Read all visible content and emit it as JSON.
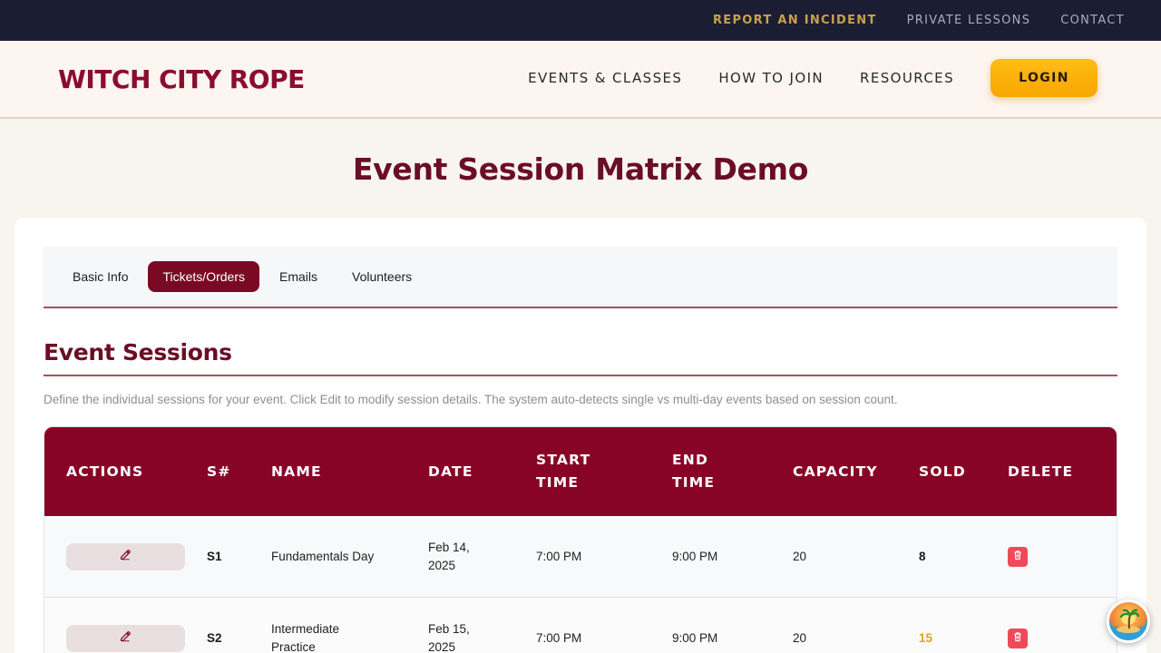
{
  "utility_nav": {
    "report_incident": "REPORT AN INCIDENT",
    "private_lessons": "PRIVATE LESSONS",
    "contact": "CONTACT"
  },
  "header": {
    "logo": "WITCH CITY ROPE",
    "nav": {
      "events": "EVENTS & CLASSES",
      "join": "HOW TO JOIN",
      "resources": "RESOURCES"
    },
    "login": "LOGIN"
  },
  "page": {
    "title": "Event Session Matrix Demo"
  },
  "tabs": [
    "Basic Info",
    "Tickets/Orders",
    "Emails",
    "Volunteers"
  ],
  "active_tab": "Tickets/Orders",
  "sessions": {
    "title": "Event Sessions",
    "description": "Define the individual sessions for your event. Click Edit to modify session details. The system auto-detects single vs multi-day events based on session count.",
    "columns": {
      "actions": "ACTIONS",
      "snum": "S#",
      "name": "NAME",
      "date": "DATE",
      "start": "START TIME",
      "end": "END TIME",
      "capacity": "CAPACITY",
      "sold": "SOLD",
      "delete": "DELETE"
    },
    "rows": [
      {
        "snum": "S1",
        "name": "Fundamentals Day",
        "date": "Feb 14, 2025",
        "start": "7:00 PM",
        "end": "9:00 PM",
        "capacity": "20",
        "sold": "8"
      },
      {
        "snum": "S2",
        "name": "Intermediate Practice",
        "date": "Feb 15, 2025",
        "start": "7:00 PM",
        "end": "9:00 PM",
        "capacity": "20",
        "sold": "15"
      }
    ]
  },
  "colors": {
    "brand": "#880427",
    "accent": "#ffb30e",
    "sold_warning": "#e0a21b",
    "delete": "#ef4a5a"
  },
  "icons": {
    "edit": "edit-icon",
    "delete": "trash-icon"
  }
}
